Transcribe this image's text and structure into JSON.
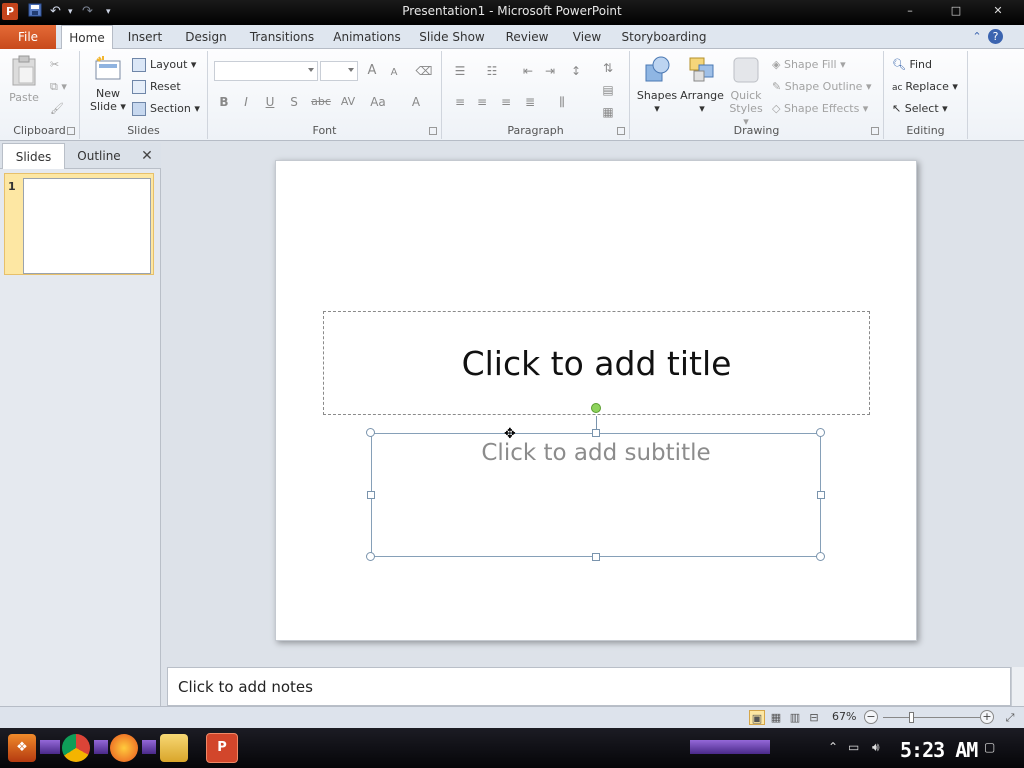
{
  "window": {
    "title": "Presentation1 - Microsoft PowerPoint",
    "app_icon": "P",
    "minimize": "–",
    "maximize": "□",
    "close": "✕"
  },
  "ribbon_tabs": [
    "File",
    "Home",
    "Insert",
    "Design",
    "Transitions",
    "Animations",
    "Slide Show",
    "Review",
    "View",
    "Storyboarding"
  ],
  "active_tab": "Home",
  "clipboard": {
    "label": "Clipboard",
    "paste": "Paste"
  },
  "slides_group": {
    "label": "Slides",
    "new_slide_line1": "New",
    "new_slide_line2": "Slide",
    "layout": "Layout",
    "reset": "Reset",
    "section": "Section"
  },
  "font_group": {
    "label": "Font",
    "bold": "B",
    "italic": "I",
    "underline": "U",
    "shadow": "S",
    "strike": "abc",
    "spacing": "AV",
    "case": "Aa",
    "color": "A",
    "grow": "A",
    "shrink": "A"
  },
  "paragraph_group": {
    "label": "Paragraph"
  },
  "drawing_group": {
    "label": "Drawing",
    "shapes": "Shapes",
    "arrange": "Arrange",
    "quick_styles_line1": "Quick",
    "quick_styles_line2": "Styles",
    "shape_fill": "Shape Fill",
    "shape_outline": "Shape Outline",
    "shape_effects": "Shape Effects"
  },
  "editing_group": {
    "label": "Editing",
    "find": "Find",
    "replace": "Replace",
    "select": "Select"
  },
  "slides_pane": {
    "tab_slides": "Slides",
    "tab_outline": "Outline",
    "close": "✕",
    "slide_number": "1"
  },
  "slide": {
    "title_placeholder": "Click to add title",
    "subtitle_placeholder": "Click to add subtitle"
  },
  "notes": {
    "placeholder": "Click to add notes"
  },
  "statusbar": {
    "zoom": "67%",
    "zoom_out": "−",
    "zoom_in": "+"
  },
  "taskbar": {
    "clock": "5:23 AM"
  }
}
